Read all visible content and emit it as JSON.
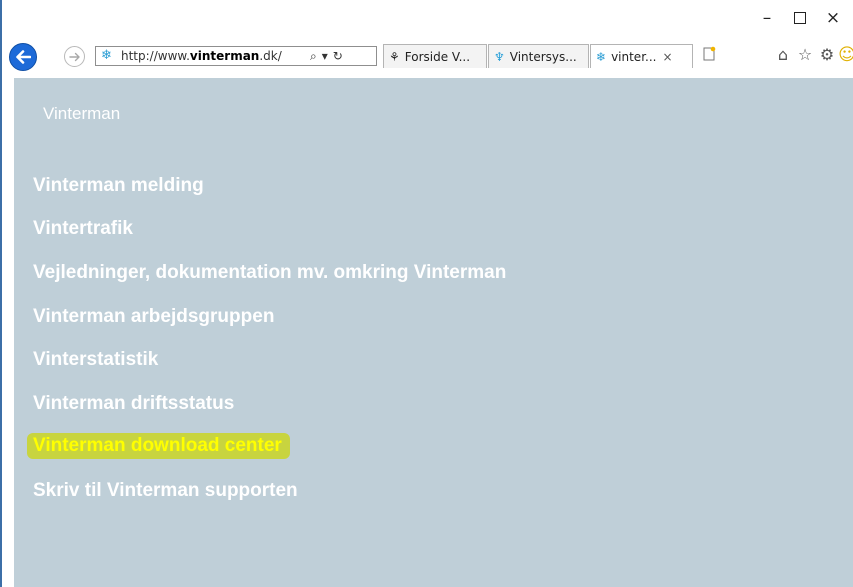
{
  "window_controls": {
    "minimize": "–",
    "maximize": "",
    "close": "×"
  },
  "address_bar": {
    "favicon": "snowflake-icon",
    "url_prefix": "http://www.",
    "url_host": "vinterman",
    "url_suffix": ".dk/",
    "search": "⌕",
    "dropdown": "▾",
    "refresh": "↻"
  },
  "tabs": [
    {
      "label": "Forside V...",
      "icon": "⚘"
    },
    {
      "label": "Vintersys...",
      "icon": "♆"
    },
    {
      "label": "vinter...",
      "icon": "❄",
      "close": "×"
    }
  ],
  "toolbar": {
    "home": "⌂",
    "favorites": "☆",
    "settings": "⚙",
    "feedback": "☺"
  },
  "page": {
    "title": "Vinterman",
    "nav": [
      "Vinterman melding",
      "Vintertrafik",
      "Vejledninger, dokumentation mv. omkring Vinterman",
      "Vinterman arbejdsgruppen",
      "Vinterstatistik",
      "Vinterman driftsstatus",
      "Vinterman download center",
      "Skriv til Vinterman supporten"
    ]
  },
  "colors": {
    "page_bg": "#bfcfd8",
    "link": "#ffffff",
    "highlight_text": "#ffff00",
    "highlight_bg": "#c8d43f",
    "back_button": "#1d6ad8"
  }
}
